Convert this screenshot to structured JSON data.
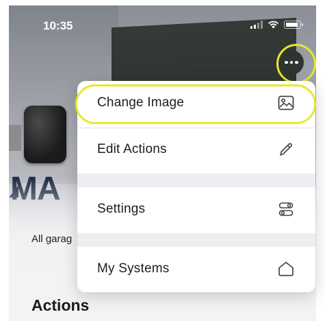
{
  "status": {
    "time": "10:35"
  },
  "photo": {
    "brand_text": "MA"
  },
  "caption": "All garag",
  "section_title": "Actions",
  "menu": {
    "items": [
      {
        "label": "Change Image",
        "icon": "image-icon"
      },
      {
        "label": "Edit Actions",
        "icon": "pencil-icon"
      },
      {
        "label": "Settings",
        "icon": "toggles-icon"
      },
      {
        "label": "My Systems",
        "icon": "home-icon"
      }
    ]
  },
  "colors": {
    "highlight": "#e6e92b",
    "more_button_bg": "#2f3432",
    "menu_bg": "#ffffff",
    "menu_gap": "#eeeef2"
  }
}
